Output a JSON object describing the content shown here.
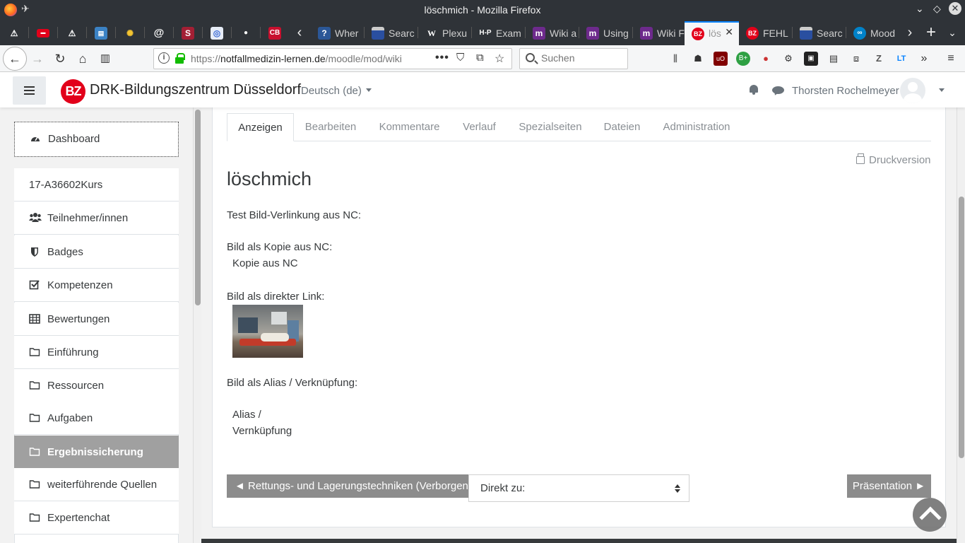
{
  "window": {
    "title": "löschmich - Mozilla Firefox"
  },
  "tabs": [
    {
      "label": "",
      "icon": "warning-icon",
      "color": "#ffffff"
    },
    {
      "label": "",
      "icon": "red-site-icon",
      "color": "#e2001a"
    },
    {
      "label": "",
      "icon": "warning-icon",
      "color": "#ffffff"
    },
    {
      "label": "",
      "icon": "card-icon",
      "color": "#3b82c4"
    },
    {
      "label": "",
      "icon": "sun-icon",
      "color": "#f4c430"
    },
    {
      "label": "",
      "icon": "at-icon",
      "color": "#ffffff"
    },
    {
      "label": "",
      "icon": "s-icon",
      "color": "#a31f34"
    },
    {
      "label": "",
      "icon": "globe-icon",
      "color": "#3b6bd6"
    },
    {
      "label": "",
      "icon": "dot-icon",
      "color": "#ffffff"
    },
    {
      "label": "",
      "icon": "cb-icon",
      "color": "#c8102e"
    },
    {
      "label": "Wher",
      "icon": "question-icon",
      "color": "#2b5797"
    },
    {
      "label": "Searc",
      "icon": "window-icon",
      "color": "#2a4fa0"
    },
    {
      "label": "Plexu",
      "icon": "wikipedia-icon",
      "color": "#ffffff"
    },
    {
      "label": "Exam",
      "icon": "h5p-icon",
      "color": "#ffffff"
    },
    {
      "label": "Wiki a",
      "icon": "moodle-m-icon",
      "color": "#6d2a8c"
    },
    {
      "label": "Using",
      "icon": "moodle-m-icon",
      "color": "#6d2a8c"
    },
    {
      "label": "Wiki F",
      "icon": "moodle-m-icon",
      "color": "#6d2a8c"
    },
    {
      "label": "lös",
      "icon": "bz-icon",
      "color": "#e2001a",
      "active": true
    },
    {
      "label": "FEHL",
      "icon": "bz-icon",
      "color": "#e2001a"
    },
    {
      "label": "Searc",
      "icon": "window-icon",
      "color": "#2a4fa0"
    },
    {
      "label": "Mood",
      "icon": "nextcloud-icon",
      "color": "#0082c9"
    }
  ],
  "toolbar": {
    "url_prefix": "https://",
    "url_domain": "notfallmedizin-lernen.de",
    "url_path": "/moodle/mod/wiki",
    "search_placeholder": "Suchen"
  },
  "site": {
    "logo_text": "BZ",
    "name": "DRK-Bildungszentrum Düsseldorf",
    "language": "Deutsch (de)",
    "user": "Thorsten Rochelmeyer",
    "brand_color": "#e2001a"
  },
  "drawer": {
    "dashboard": "Dashboard",
    "items": [
      {
        "label": "17-A36602Kurs",
        "icon": ""
      },
      {
        "label": "Teilnehmer/innen",
        "icon": "users-icon"
      },
      {
        "label": "Badges",
        "icon": "shield-icon"
      },
      {
        "label": "Kompetenzen",
        "icon": "checkbox-icon"
      },
      {
        "label": "Bewertungen",
        "icon": "table-icon"
      },
      {
        "label": "Einführung",
        "icon": "folder-icon"
      },
      {
        "label": "Ressourcen",
        "icon": "folder-icon"
      },
      {
        "label": "Aufgaben",
        "icon": "folder-icon"
      },
      {
        "label": "Ergebnissicherung",
        "icon": "folder-icon",
        "active": true
      },
      {
        "label": "weiterführende Quellen",
        "icon": "folder-icon"
      },
      {
        "label": "Expertenchat",
        "icon": "folder-icon"
      }
    ]
  },
  "wiki": {
    "tabs": [
      "Anzeigen",
      "Bearbeiten",
      "Kommentare",
      "Verlauf",
      "Spezialseiten",
      "Dateien",
      "Administration"
    ],
    "print_label": "Druckversion",
    "title": "löschmich",
    "lines": {
      "l1": "Test Bild-Verlinkung aus NC:",
      "l2": "Bild als Kopie aus NC:",
      "l3": "Kopie aus NC",
      "l4": "Bild als direkter Link:",
      "l5": "Bild als Alias / Verknüpfung:",
      "l6": "Alias /",
      "l7": "Vernküpfung"
    },
    "prev_button": "◄ Rettungs- und Lagerungstechniken (Verborgen)",
    "jump_label": "Direkt zu:",
    "next_button": "Präsentation ►"
  }
}
